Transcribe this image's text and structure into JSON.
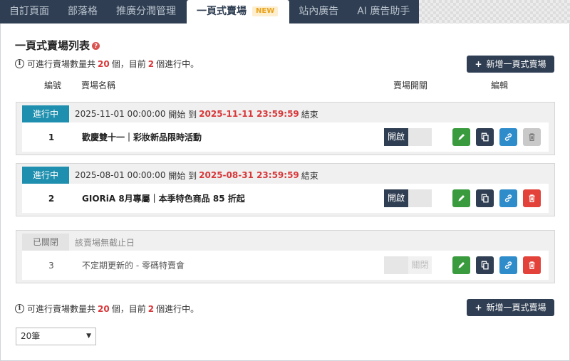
{
  "tabs": [
    {
      "label": "自訂頁面"
    },
    {
      "label": "部落格"
    },
    {
      "label": "推廣分潤管理"
    },
    {
      "label": "一頁式賣場",
      "badge": "NEW",
      "active": true
    },
    {
      "label": "站內廣告"
    },
    {
      "label": "AI 廣告助手"
    }
  ],
  "page": {
    "title": "一頁式賣場列表",
    "info": {
      "prefix": "可進行賣場數量共",
      "total": "20",
      "mid": "個，目前",
      "current": "2",
      "suffix": "個進行中。"
    },
    "add_button": "新增一頁式賣場",
    "columns": {
      "no": "編號",
      "name": "賣場名稱",
      "toggle": "賣場開關",
      "edit": "編輯"
    },
    "page_size": "20筆"
  },
  "stores": [
    {
      "status": "進行中",
      "start": "2025-11-01 00:00:00",
      "start_word": "開始",
      "to": "到",
      "end": "2025-11-11 23:59:59",
      "end_word": "結束",
      "no": "1",
      "name": "歡慶雙十一｜彩妝新品限時活動",
      "toggle": "開啟",
      "active": true,
      "delete_disabled": true
    },
    {
      "status": "進行中",
      "start": "2025-08-01 00:00:00",
      "start_word": "開始",
      "to": "到",
      "end": "2025-08-31 23:59:59",
      "end_word": "結束",
      "no": "2",
      "name": "GIORiA 8月專屬｜本季特色商品 85 折起",
      "toggle": "開啟",
      "active": true,
      "delete_disabled": false
    },
    {
      "status": "已關閉",
      "note": "該賣場無截止日",
      "no": "3",
      "name": "不定期更新的 - 零碼特賣會",
      "toggle": "關閉",
      "active": false,
      "delete_disabled": false
    }
  ],
  "colors": {
    "navy": "#2f3e52",
    "teal": "#1e8fae",
    "red": "#d9383a",
    "green": "#3a9b3e",
    "blue": "#2f8ccb"
  }
}
